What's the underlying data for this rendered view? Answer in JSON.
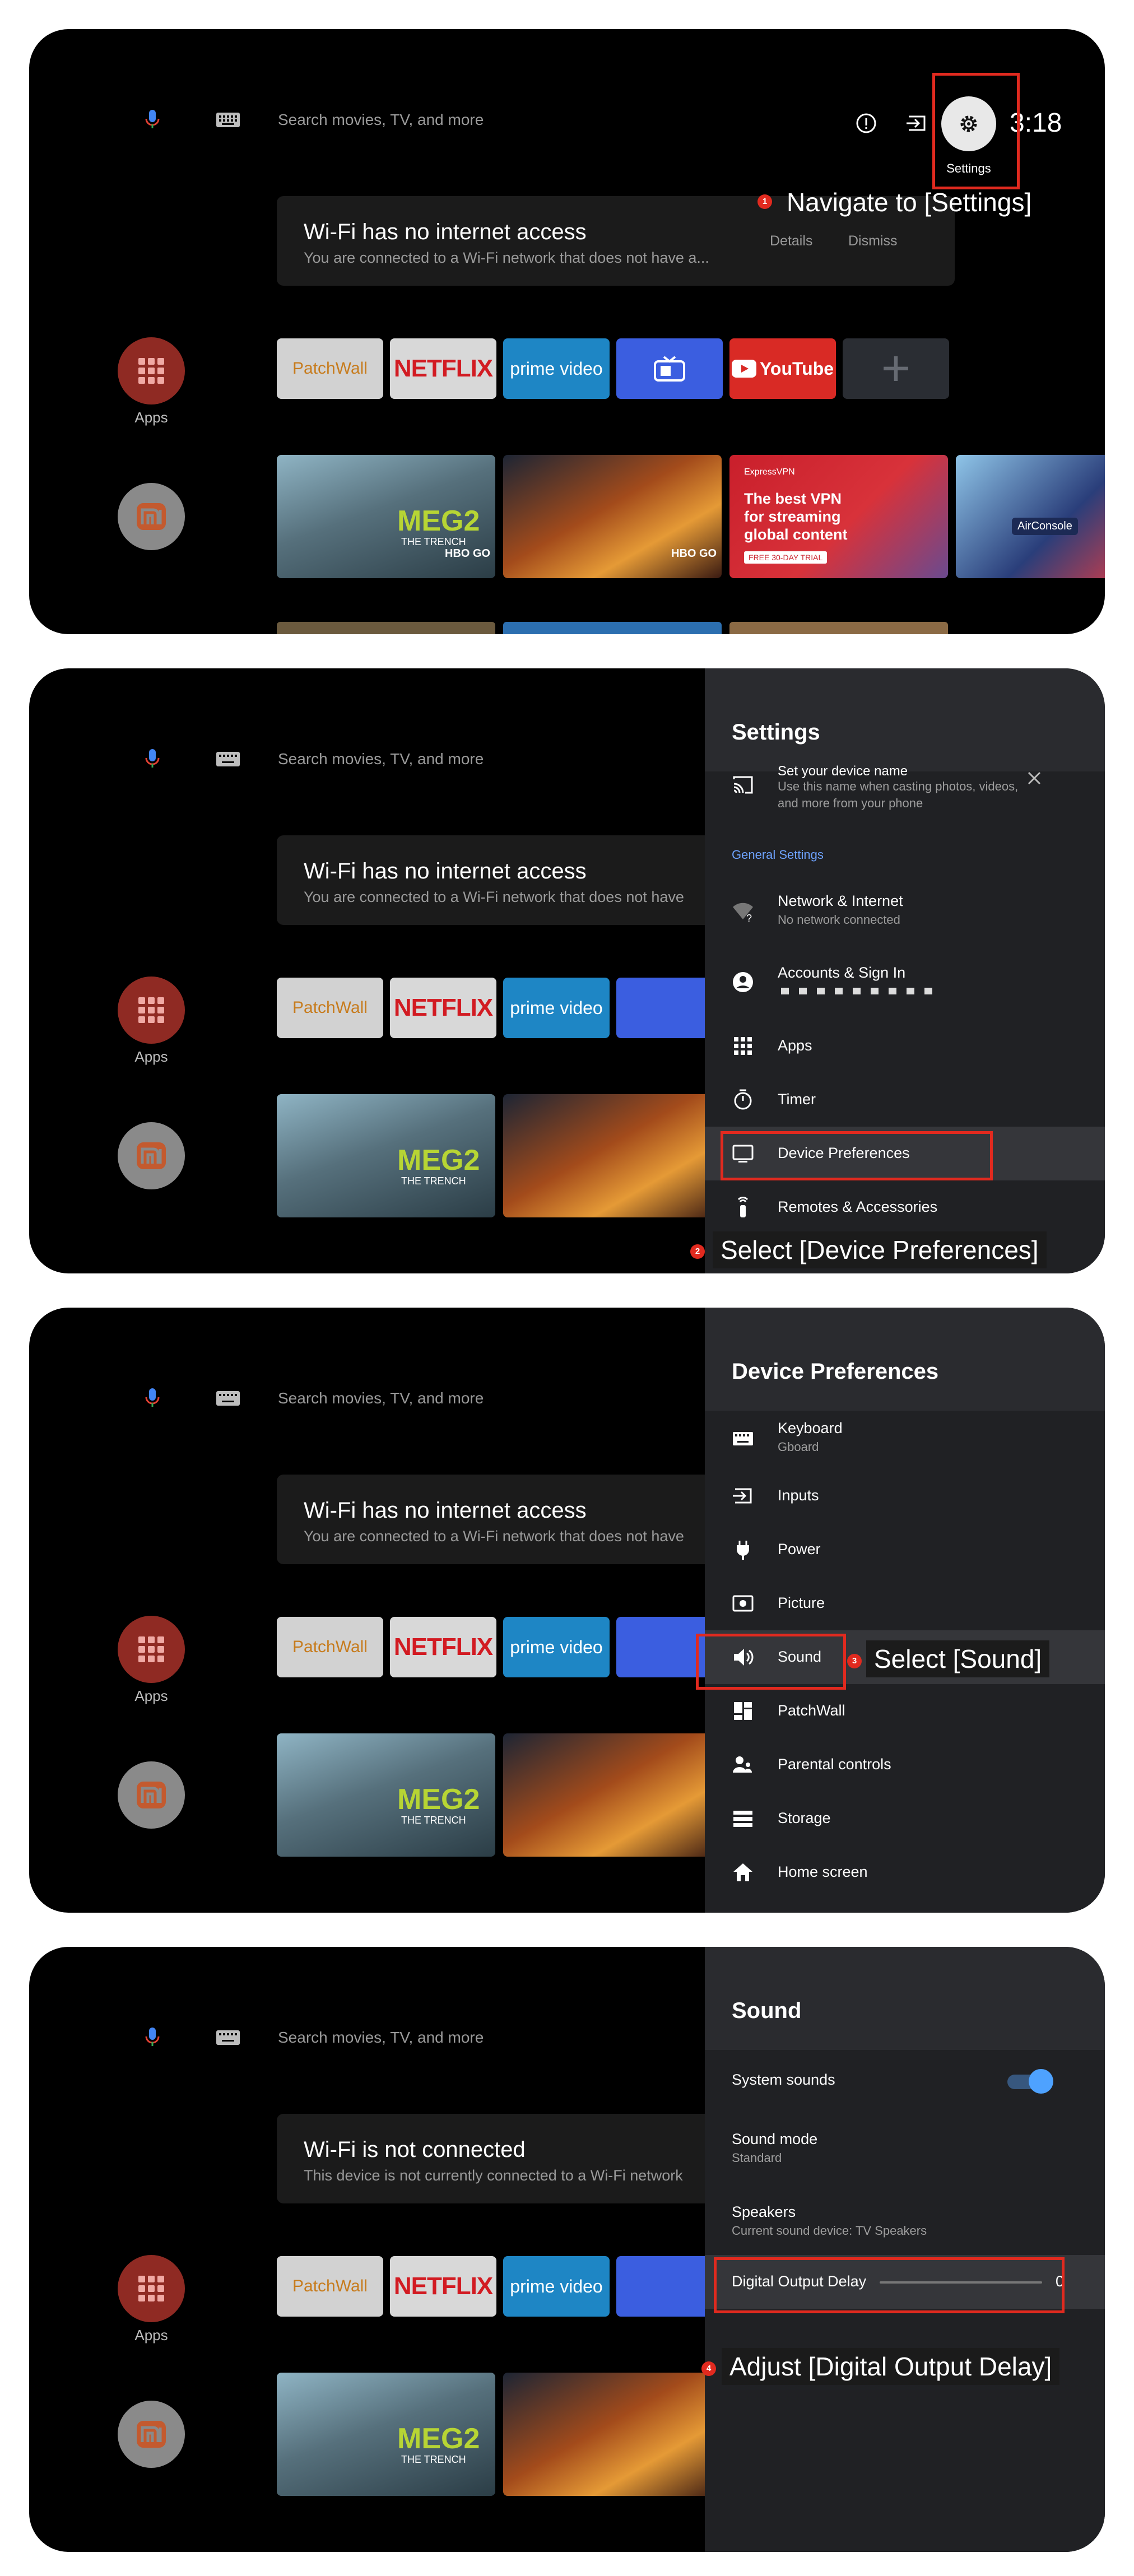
{
  "search": {
    "placeholder": "Search movies, TV, and more"
  },
  "clock": "3:18",
  "settings_label": "Settings",
  "notice_1": {
    "title": "Wi-Fi has no internet access",
    "subtitle": "You are connected to a Wi-Fi network that does not have a...",
    "subtitle_cut": "You are connected to a Wi-Fi network that does not have",
    "details": "Details",
    "dismiss": "Dismiss"
  },
  "notice_2": {
    "title": "Wi-Fi is not connected",
    "subtitle": "This device is not currently connected to a Wi-Fi network"
  },
  "apps_label": "Apps",
  "tiles": {
    "patchwall": "PatchWall",
    "netflix": "NETFLIX",
    "prime": "prime video",
    "youtube": "YouTube",
    "plus": "+"
  },
  "content": {
    "meg_title": "MEG2",
    "meg_sub": "THE TRENCH",
    "hbo": "HBO GO",
    "vpn_brand": "ExpressVPN",
    "vpn_text": "The best VPN for streaming global content",
    "vpn_trial": "FREE 30-DAY TRIAL",
    "air": "AirConsole"
  },
  "settings_panel": {
    "title": "Settings",
    "device_name": "Set your device name",
    "device_name_desc": "Use this name when casting photos, videos, and more from your phone",
    "section": "General Settings",
    "network": "Network & Internet",
    "network_sub": "No network connected",
    "accounts": "Accounts & Sign In",
    "apps": "Apps",
    "timer": "Timer",
    "device_prefs": "Device Preferences",
    "remotes": "Remotes & Accessories"
  },
  "device_prefs_panel": {
    "title": "Device Preferences",
    "keyboard": "Keyboard",
    "keyboard_sub": "Gboard",
    "inputs": "Inputs",
    "power": "Power",
    "picture": "Picture",
    "sound": "Sound",
    "patchwall": "PatchWall",
    "parental": "Parental controls",
    "storage": "Storage",
    "home": "Home screen"
  },
  "sound_panel": {
    "title": "Sound",
    "system_sounds": "System sounds",
    "system_sounds_on": true,
    "sound_mode": "Sound mode",
    "sound_mode_sub": "Standard",
    "speakers": "Speakers",
    "speakers_sub": "Current sound device: TV Speakers",
    "delay": "Digital Output Delay",
    "delay_value": "0"
  },
  "steps": [
    {
      "num": "1",
      "text": "Navigate to [Settings]"
    },
    {
      "num": "2",
      "text": "Select [Device Preferences]"
    },
    {
      "num": "3",
      "text": "Select [Sound]"
    },
    {
      "num": "4",
      "text": "Adjust [Digital Output Delay]"
    }
  ],
  "colors": {
    "annotation": "#e12a1f",
    "accent": "#4ea2ff",
    "section": "#6ea3ff"
  }
}
